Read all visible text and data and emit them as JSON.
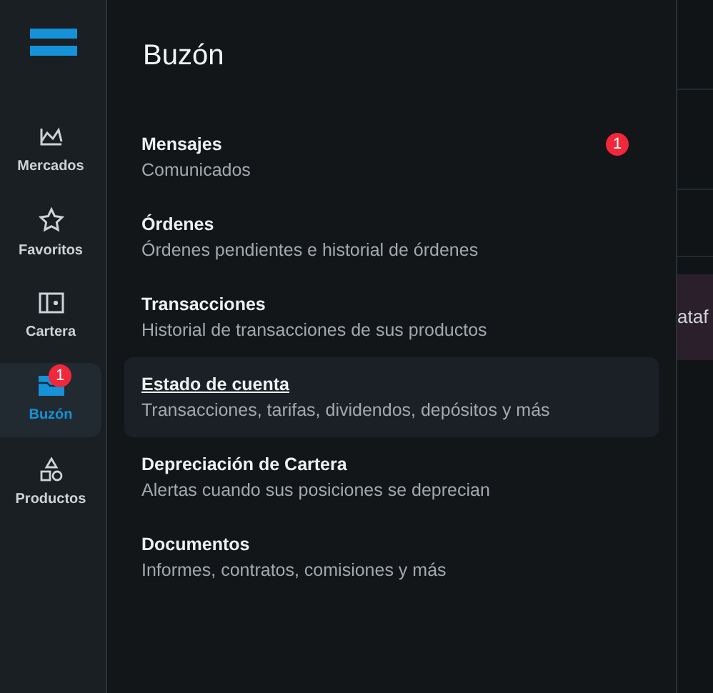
{
  "sidebar": {
    "items": [
      {
        "label": "Mercados",
        "kind": "chart",
        "selected": false
      },
      {
        "label": "Favoritos",
        "kind": "star",
        "selected": false
      },
      {
        "label": "Cartera",
        "kind": "wallet",
        "selected": false
      },
      {
        "label": "Buzón",
        "kind": "inbox",
        "selected": true,
        "badge": "1"
      },
      {
        "label": "Productos",
        "kind": "shapes",
        "selected": false
      }
    ]
  },
  "drawer": {
    "title": "Buzón",
    "items": [
      {
        "title": "Mensajes",
        "subtitle": "Comunicados",
        "selected": false,
        "badge": "1"
      },
      {
        "title": "Órdenes",
        "subtitle": "Órdenes pendientes e historial de órdenes",
        "selected": false
      },
      {
        "title": "Transacciones",
        "subtitle": "Historial de transacciones de sus productos",
        "selected": false
      },
      {
        "title": "Estado de cuenta",
        "subtitle": "Transacciones, tarifas, dividendos, depósitos y más",
        "selected": true
      },
      {
        "title": "Depreciación de Cartera",
        "subtitle": "Alertas cuando sus posiciones se deprecian",
        "selected": false
      },
      {
        "title": "Documentos",
        "subtitle": "Informes, contratos, comisiones y más",
        "selected": false
      }
    ]
  },
  "background": {
    "partial_text": "ataf"
  }
}
